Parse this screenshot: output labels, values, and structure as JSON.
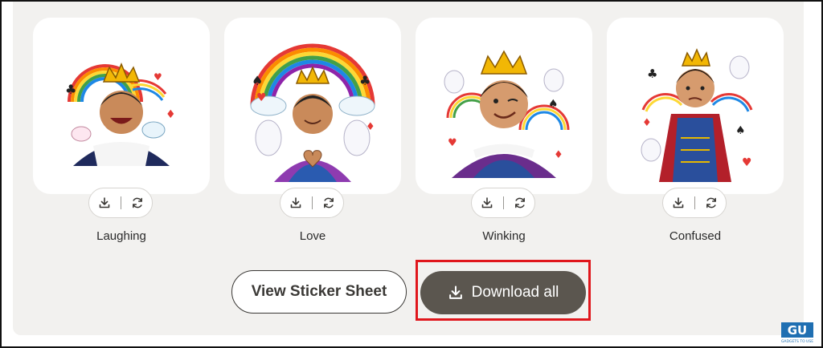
{
  "stickers": [
    {
      "label": "Laughing"
    },
    {
      "label": "Love"
    },
    {
      "label": "Winking"
    },
    {
      "label": "Confused"
    }
  ],
  "actions": {
    "download_icon": "download-icon",
    "regenerate_icon": "refresh-icon"
  },
  "buttons": {
    "view_sheet": "View Sticker Sheet",
    "download_all": "Download all"
  },
  "watermark": {
    "logo_text": "GU",
    "tagline": "GADGETS TO USE"
  },
  "colors": {
    "panel_bg": "#f2f1ef",
    "primary_button": "#5b564f",
    "highlight_box": "#e0161c"
  }
}
